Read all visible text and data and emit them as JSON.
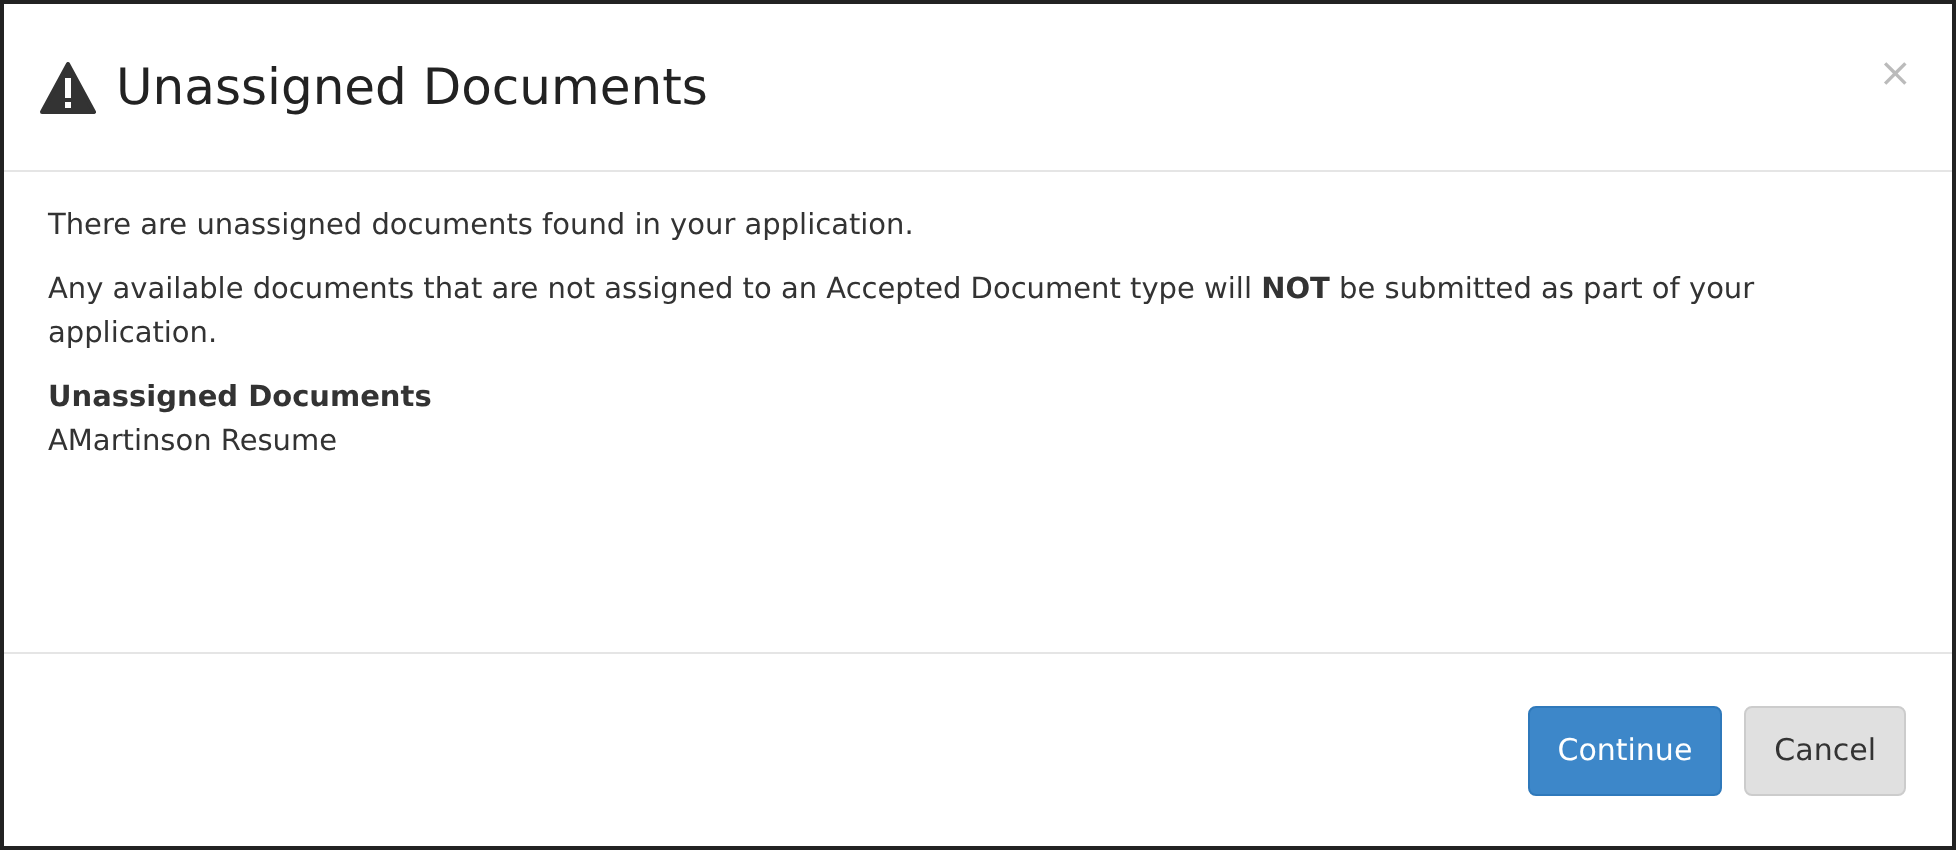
{
  "dialog": {
    "title": "Unassigned Documents",
    "close": "×"
  },
  "body": {
    "paragraphs": [
      "There are unassigned documents found in your application.",
      "Any available documents that are not assigned to an Accepted Document type will **NOT** be submitted as part of your application."
    ],
    "list_heading": "Unassigned Documents",
    "documents": [
      "AMartinson Resume"
    ]
  },
  "buttons": [
    {
      "label": "Continue",
      "kind": "primary"
    },
    {
      "label": "Cancel",
      "kind": "default"
    }
  ]
}
